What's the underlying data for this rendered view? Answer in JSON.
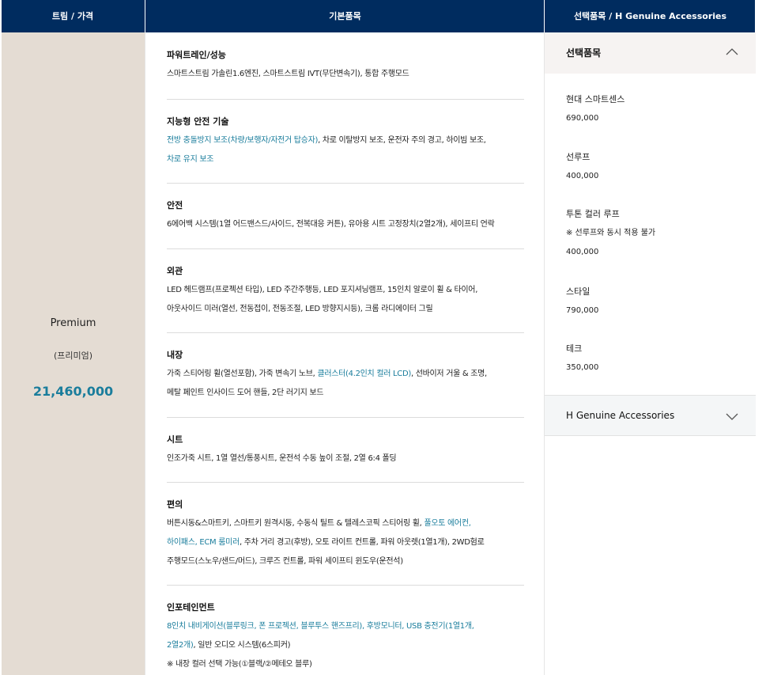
{
  "header": {
    "col1": "트림 / 가격",
    "col2": "기본품목",
    "col3": "선택품목 / H Genuine Accessories"
  },
  "trim": {
    "name": "Premium",
    "sub": "(프리미엄)",
    "price": "21,460,000"
  },
  "basic": {
    "sections": [
      {
        "title": "파워트레인/성능",
        "lines": [
          [
            {
              "t": "스마트스트림 가솔린1.6엔진, 스마트스트림 IVT(무단변속기), 통합 주행모드"
            }
          ]
        ]
      },
      {
        "title": "지능형 안전 기술",
        "lines": [
          [
            {
              "t": "전방 충돌방지 보조(차량/보행자/자전거 탑승자)",
              "hl": true
            },
            {
              "t": ", 차로 이탈방지 보조, 운전자 주의 경고, 하이빔 보조,"
            }
          ],
          [
            {
              "t": "차로 유지 보조",
              "hl": true
            }
          ]
        ]
      },
      {
        "title": "안전",
        "lines": [
          [
            {
              "t": "6에어백 시스템(1열 어드밴스드/사이드, 전복대응 커튼), 유아용 시트 고정장치(2열2개), 세이프티 언락"
            }
          ]
        ]
      },
      {
        "title": "외관",
        "lines": [
          [
            {
              "t": "LED 헤드램프(프로젝션 타입), LED 주간주행등, LED 포지셔닝램프, 15인치 알로이 휠 & 타이어,"
            }
          ],
          [
            {
              "t": "아웃사이드 미러(열선, 전동접이, 전동조절, LED 방향지시등), 크롬 라디에이터 그릴"
            }
          ]
        ]
      },
      {
        "title": "내장",
        "lines": [
          [
            {
              "t": "가죽 스티어링 휠(열선포함), 가죽 변속기 노브, "
            },
            {
              "t": "클러스터(4.2인치 컬러 LCD)",
              "hl": true
            },
            {
              "t": ", 선바이저 거울 & 조명,"
            }
          ],
          [
            {
              "t": "메탈 페인트 인사이드 도어 핸들, 2단 러기지 보드"
            }
          ]
        ]
      },
      {
        "title": "시트",
        "lines": [
          [
            {
              "t": "인조가죽 시트, 1열 열선/통풍시트, 운전석 수동 높이 조절, 2열 6:4 폴딩"
            }
          ]
        ]
      },
      {
        "title": "편의",
        "lines": [
          [
            {
              "t": "버튼시동&스마트키, 스마트키 원격시동, 수동식 틸트 & 텔레스코픽 스티어링 휠, "
            },
            {
              "t": "풀오토 에어컨,",
              "hl": true
            }
          ],
          [
            {
              "t": "하이패스, ECM 룸미러",
              "hl": true
            },
            {
              "t": ", 주차 거리 경고(후방), 오토 라이트 컨트롤, 파워 아웃렛(1열1개), 2WD험로"
            }
          ],
          [
            {
              "t": "주행모드(스노우/샌드/머드), 크루즈 컨트롤, 파워 세이프티 윈도우(운전석)"
            }
          ]
        ]
      },
      {
        "title": "인포테인먼트",
        "lines": [
          [
            {
              "t": "8인치 내비게이션(블루링크, 폰 프로젝션, 블루투스 핸즈프리), 후방모니터, USB 충전기(1열1개,",
              "hl": true
            }
          ],
          [
            {
              "t": "2열2개)",
              "hl": true
            },
            {
              "t": ", 일반 오디오 시스템(6스피커)"
            }
          ],
          [
            {
              "t": "※ 내장 컬러 선택 가능(①블랙/②메테오 블루)"
            }
          ]
        ]
      }
    ]
  },
  "options": {
    "accordion_title": "선택품목",
    "items": [
      {
        "name": "현대 스마트센스",
        "note": "",
        "price": "690,000"
      },
      {
        "name": "선루프",
        "note": "",
        "price": "400,000"
      },
      {
        "name": "투톤 컬러 루프",
        "note": "※ 선루프와 동시 적용 불가",
        "price": "400,000"
      },
      {
        "name": "스타일",
        "note": "",
        "price": "790,000"
      },
      {
        "name": "테크",
        "note": "",
        "price": "350,000"
      }
    ],
    "accessories_title": "H Genuine Accessories",
    "icons": {
      "expanded": "chevron-up-icon",
      "collapsed": "chevron-down-icon"
    }
  },
  "colors": {
    "header": "#002c5f",
    "trim_bg": "#e4dcd3",
    "accent": "#1a7d9c"
  }
}
